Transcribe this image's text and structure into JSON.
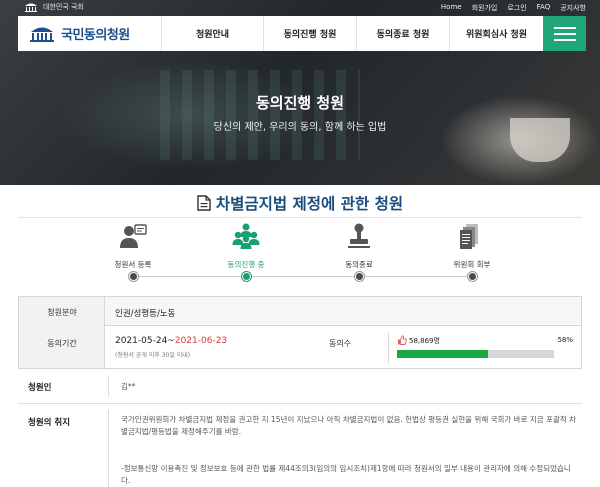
{
  "util": {
    "org": "대한민국 국회",
    "links": [
      "Home",
      "회원가입",
      "로그인",
      "FAQ",
      "공지사항"
    ]
  },
  "nav": {
    "logo": "국민동의청원",
    "menu": [
      "청원안내",
      "동의진행 청원",
      "동의종료 청원",
      "위원회심사 청원"
    ],
    "accent": "#20a777"
  },
  "hero": {
    "title": "동의진행 청원",
    "subtitle": "당신의 제안, 우리의 동의, 함께 하는 입법"
  },
  "petition": {
    "title": "차별금지법 제정에 관한 청원",
    "steps": [
      {
        "label": "청원서 등록",
        "icon": "register-icon",
        "active": false
      },
      {
        "label": "동의진행 중",
        "icon": "people-icon",
        "active": true
      },
      {
        "label": "동의종료",
        "icon": "stamp-icon",
        "active": false
      },
      {
        "label": "위원회 회부",
        "icon": "documents-icon",
        "active": false
      }
    ],
    "info": {
      "category_label": "청원분야",
      "category": "인권/성평등/노동",
      "period_label": "동의기간",
      "period_start": "2021-05-24~",
      "period_end": "2021-06-23",
      "period_note": "(청원서 공개 이후 30일 이내)",
      "agree_label": "동의수",
      "agree_count": "58,869명",
      "agree_percent": "58%",
      "progress": 0.58,
      "progress_color": "#18a840"
    },
    "author_label": "청원인",
    "author": "김**",
    "purpose_label": "청원의 취지",
    "purpose_p1": "국가인권위원회가 차별금지법 제정을 권고한 지 15년이 지났으나 아직 차별금지법이 없음. 헌법상 평등권 실현을 위해 국회가 바로 지금 포괄적 차별금지법/평등법을 제정해주기를 바람.",
    "purpose_p2": "-정보통신망 이용촉진 및 정보보호 등에 관한 법률 제44조의3(임의의 임시조치)제1항에 따라 청원서의 일부 내용이 관리자에 의해 수정되었습니다."
  }
}
